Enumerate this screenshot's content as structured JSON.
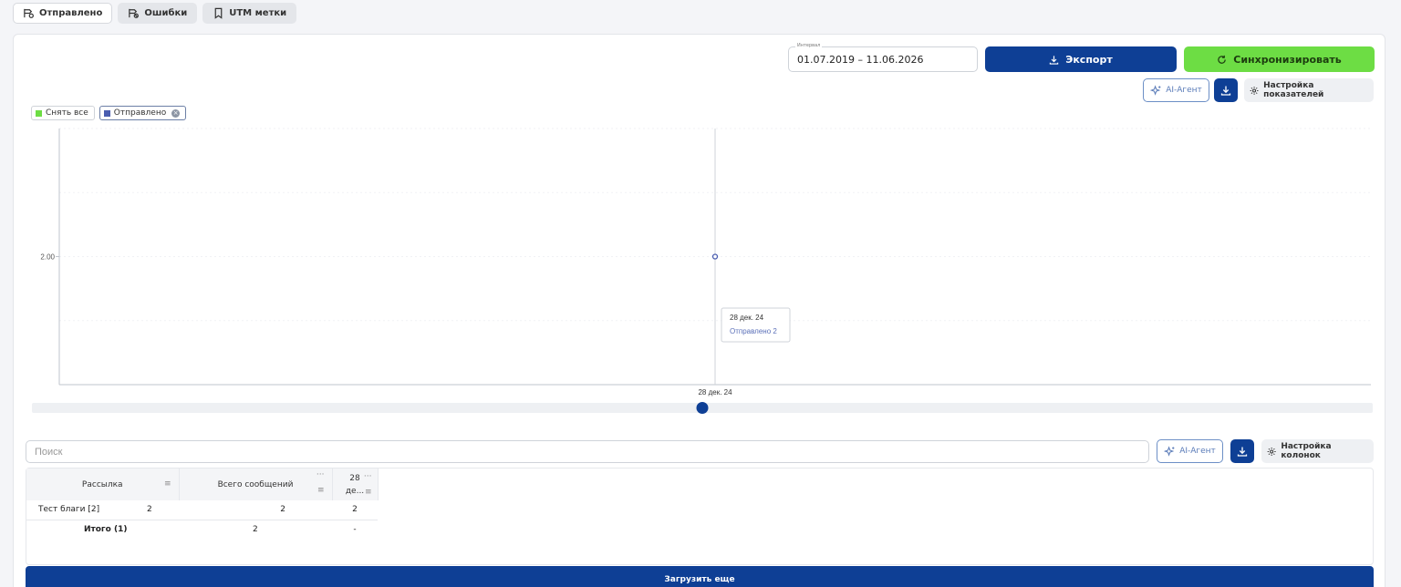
{
  "tabs": [
    {
      "label": "Отправлено",
      "icon": "sent-icon",
      "active": true
    },
    {
      "label": "Ошибки",
      "icon": "errors-icon",
      "active": false
    },
    {
      "label": "UTM метки",
      "icon": "bookmark-icon",
      "active": false
    }
  ],
  "toolbar": {
    "interval_label": "Интервал",
    "interval_value": "01.07.2019 – 11.06.2026",
    "export_label": "Экспорт",
    "sync_label": "Синхронизировать",
    "ai_label": "AI-Агент",
    "metrics_settings_label": "Настройка показателей"
  },
  "legend": {
    "clear_all": "Снять все",
    "series_label": "Отправлено",
    "clear_color": "#6ddd44",
    "series_color": "#4a5db0"
  },
  "chart_data": {
    "type": "line",
    "x": [
      "28 дек. 24"
    ],
    "series": [
      {
        "name": "Отправлено",
        "values": [
          2
        ]
      }
    ],
    "y_tick_labels": [
      "2.00"
    ],
    "ylim": [
      1,
      3
    ],
    "grid": true,
    "tooltip": {
      "title": "28 дек. 24",
      "series": "Отправлено",
      "value": "2"
    },
    "range_slider_value": 0.5
  },
  "table": {
    "search_placeholder": "Поиск",
    "ai_label": "AI-Агент",
    "columns_settings_label": "Настройка колонок",
    "columns": [
      "Рассылка",
      "Всего сообщений",
      "28 де..."
    ],
    "column_date_top": "28",
    "column_date_bottom": "де...",
    "rows": [
      {
        "name": "Тест благи [2]",
        "total": "2",
        "date_value": "2"
      }
    ],
    "total_row": {
      "name": "Итого (1)",
      "total": "2",
      "date_value": "-"
    },
    "load_more_label": "Загрузить еще"
  }
}
